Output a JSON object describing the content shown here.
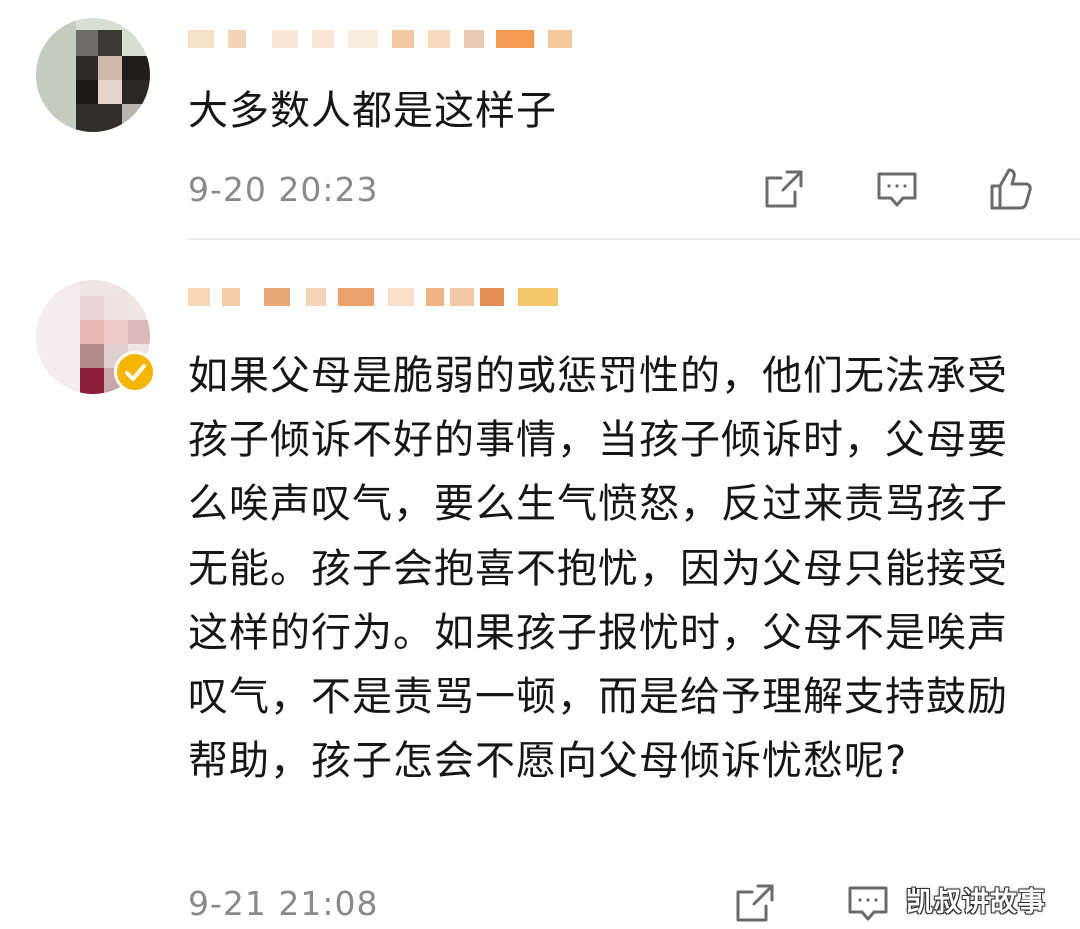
{
  "comments": [
    {
      "text": "大多数人都是这样子",
      "time": "9-20 20:23"
    },
    {
      "text": "如果父母是脆弱的或惩罚性的，他们无法承受孩子倾诉不好的事情，当孩子倾诉时，父母要么唉声叹气，要么生气愤怒，反过来责骂孩子无能。孩子会抱喜不抱忧，因为父母只能接受这样的行为。如果孩子报忧时，父母不是唉声叹气，不是责骂一顿，而是给予理解支持鼓励帮助，孩子怎会不愿向父母倾诉忧愁呢?",
      "time": "9-21 21:08"
    }
  ],
  "icons": {
    "share": "share-icon",
    "reply": "comment-icon",
    "like": "thumbs-up-icon",
    "verified": "verified-badge-icon"
  },
  "watermark": "凯叔讲故事",
  "colors": {
    "text": "#161616",
    "timestamp": "#8a8a8a",
    "icon": "#6b6b6b",
    "verified_badge": "#f7b500",
    "divider": "#ececec"
  }
}
